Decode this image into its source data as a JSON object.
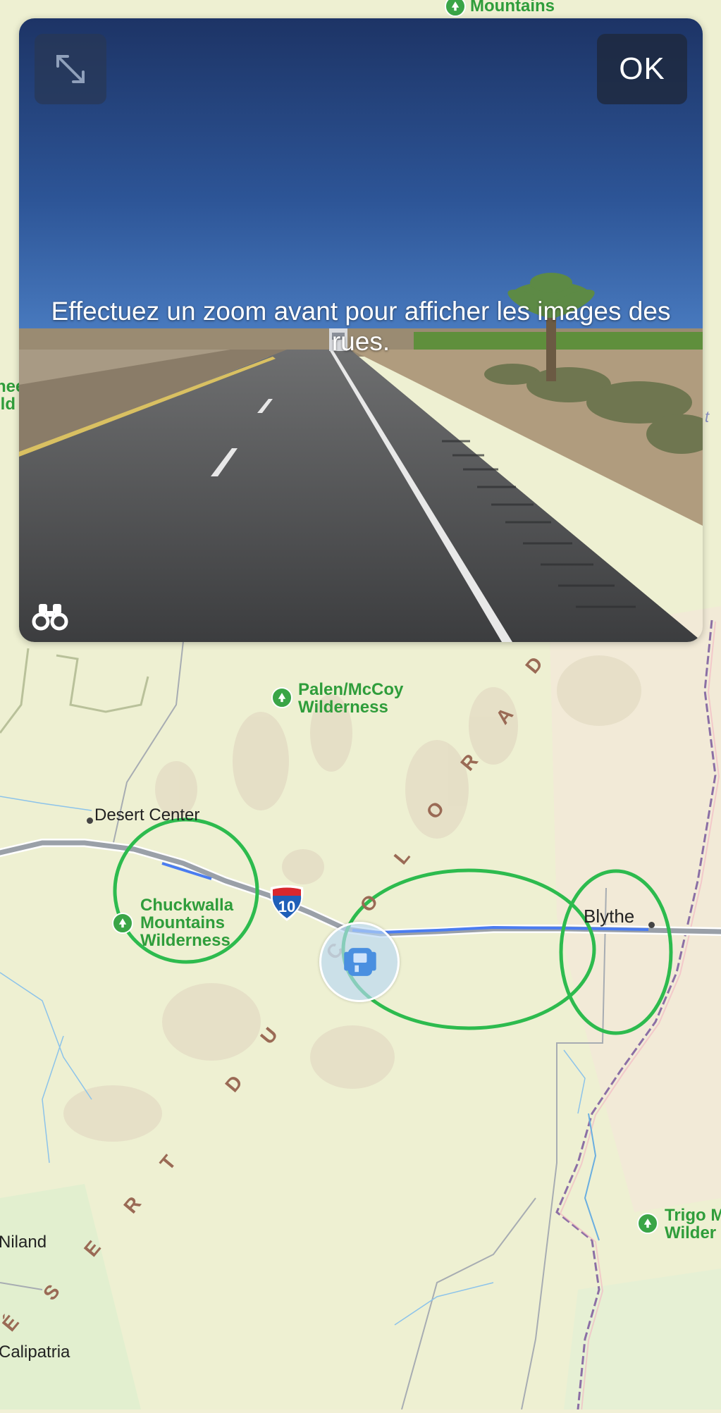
{
  "look_around": {
    "message": "Effectuez un zoom avant pour afficher les images des rues.",
    "ok_label": "OK",
    "expand_icon": "expand-arrows-icon",
    "binoculars_icon": "binoculars-icon"
  },
  "map": {
    "highway_shield": "10",
    "labels": {
      "top_park": "Mountains",
      "palen_mccoy_line1": "Palen/McCoy",
      "palen_mccoy_line2": "Wilderness",
      "chuckwalla_line1": "Chuckwalla",
      "chuckwalla_line2": "Mountains",
      "chuckwalla_line3": "Wilderness",
      "trigo_line1": "Trigo M",
      "trigo_line2": "Wilder",
      "left_cut_line1": "nee",
      "left_cut_line2": "ild",
      "right_cut": "t",
      "desert_center": "Desert Center",
      "blythe": "Blythe",
      "niland": "Niland",
      "calipatria": "Calipatria"
    },
    "region_letters": [
      "D",
      "A",
      "R",
      "O",
      "L",
      "O",
      "C",
      "U",
      "D",
      "T",
      "R",
      "E",
      "S",
      "É"
    ]
  },
  "colors": {
    "map_background": "#f1f0d6",
    "park_green": "#3aa547",
    "annotation_circle": "#2dbb4e",
    "route_blue": "#4a7cf0",
    "road_gray": "#9aa0a8"
  }
}
